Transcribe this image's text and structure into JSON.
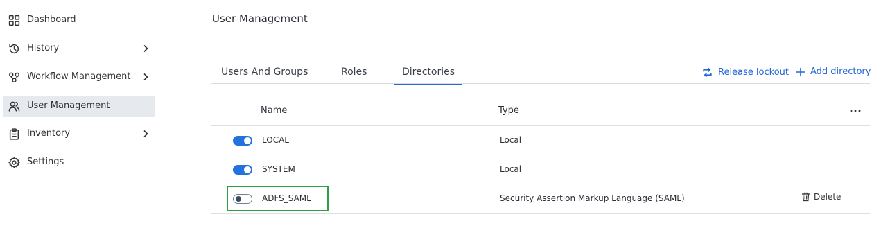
{
  "sidebar": {
    "items": [
      {
        "label": "Dashboard",
        "icon": "grid-icon",
        "has_chevron": false,
        "active": false
      },
      {
        "label": "History",
        "icon": "history-icon",
        "has_chevron": true,
        "active": false
      },
      {
        "label": "Workflow Management",
        "icon": "workflow-icon",
        "has_chevron": true,
        "active": false
      },
      {
        "label": "User Management",
        "icon": "users-icon",
        "has_chevron": false,
        "active": true
      },
      {
        "label": "Inventory",
        "icon": "clipboard-icon",
        "has_chevron": true,
        "active": false
      },
      {
        "label": "Settings",
        "icon": "gear-icon",
        "has_chevron": false,
        "active": false
      }
    ]
  },
  "header": {
    "title": "User Management"
  },
  "tabs": [
    {
      "label": "Users And Groups",
      "active": false
    },
    {
      "label": "Roles",
      "active": false
    },
    {
      "label": "Directories",
      "active": true
    }
  ],
  "actions": {
    "release_lockout": "Release lockout",
    "add_directory": "Add directory"
  },
  "table": {
    "columns": [
      "Name",
      "Type"
    ],
    "rows": [
      {
        "enabled": true,
        "name": "LOCAL",
        "type": "Local",
        "action": ""
      },
      {
        "enabled": true,
        "name": "SYSTEM",
        "type": "Local",
        "action": ""
      },
      {
        "enabled": false,
        "name": "ADFS_SAML",
        "type": "Security Assertion Markup Language (SAML)",
        "action": "Delete"
      }
    ]
  },
  "colors": {
    "accent": "#2166d6",
    "toggle_on": "#2372de",
    "active_nav_bg": "#e6e9ee",
    "highlight": "#2ea043"
  }
}
